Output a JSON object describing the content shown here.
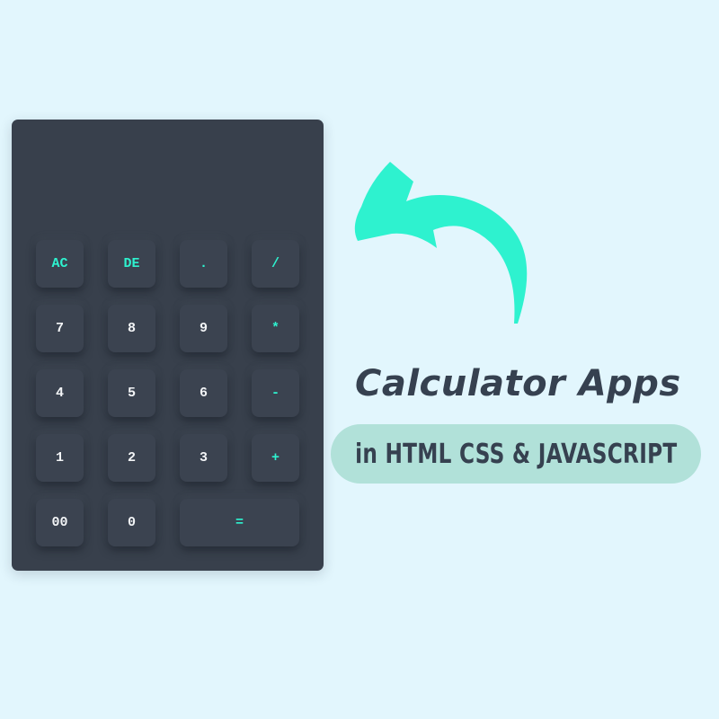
{
  "calculator": {
    "display": {
      "value": ""
    },
    "keys": [
      {
        "label": "AC",
        "accent": true
      },
      {
        "label": "DE",
        "accent": true
      },
      {
        "label": ".",
        "accent": true
      },
      {
        "label": "/",
        "accent": true
      },
      {
        "label": "7",
        "accent": false
      },
      {
        "label": "8",
        "accent": false
      },
      {
        "label": "9",
        "accent": false
      },
      {
        "label": "*",
        "accent": true
      },
      {
        "label": "4",
        "accent": false
      },
      {
        "label": "5",
        "accent": false
      },
      {
        "label": "6",
        "accent": false
      },
      {
        "label": "-",
        "accent": true
      },
      {
        "label": "1",
        "accent": false
      },
      {
        "label": "2",
        "accent": false
      },
      {
        "label": "3",
        "accent": false
      },
      {
        "label": "+",
        "accent": true
      },
      {
        "label": "00",
        "accent": false
      },
      {
        "label": "0",
        "accent": false
      },
      {
        "label": "=",
        "accent": true
      }
    ]
  },
  "headline": "Calculator Apps",
  "subheadline": "in HTML CSS & JAVASCRIPT",
  "decoration": {
    "arrow_icon": "curved-arrow-icon"
  },
  "colors": {
    "background": "#e2f6fd",
    "calculator_body": "#38404c",
    "key_face": "#3b4350",
    "accent": "#2ef2cf",
    "number_text": "#f2f4f6",
    "headline_text": "#364150",
    "pill": "#b1e1d9"
  }
}
